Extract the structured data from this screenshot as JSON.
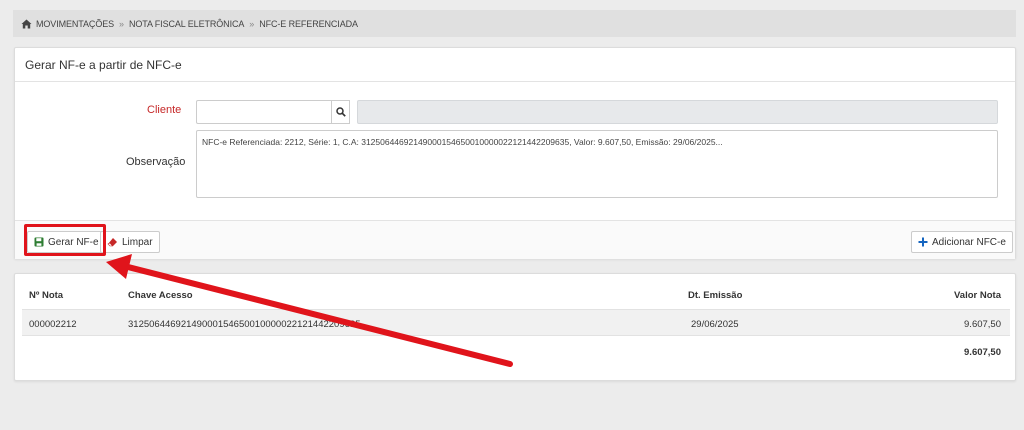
{
  "breadcrumb": {
    "items": [
      "MOVIMENTAÇÕES",
      "NOTA FISCAL ELETRÔNICA",
      "NFC-E REFERENCIADA"
    ],
    "separator": "»"
  },
  "form": {
    "title": "Gerar NF-e a partir de NFC-e",
    "cliente_label": "Cliente",
    "cliente_value": "",
    "cliente_name_value": "",
    "observacao_label": "Observação",
    "observacao_value": "NFC-e Referenciada: 2212, Série: 1, C.A: 31250644692149000154650010000022121442209635, Valor: 9.607,50, Emissão: 29/06/2025..."
  },
  "actions": {
    "gerar_label": "Gerar NF-e",
    "limpar_label": "Limpar",
    "adicionar_label": "Adicionar NFC-e"
  },
  "table": {
    "headers": {
      "numero": "Nº Nota",
      "chave": "Chave Acesso",
      "emissao": "Dt. Emissão",
      "valor": "Valor Nota"
    },
    "rows": [
      {
        "numero": "000002212",
        "chave": "31250644692149000154650010000022121442209635",
        "emissao": "29/06/2025",
        "valor": "9.607,50"
      }
    ],
    "total": "9.607,50"
  },
  "colors": {
    "highlight": "#e0141b",
    "required_label": "#c62828",
    "save_icon": "#2e7d32",
    "eraser_icon": "#c62828",
    "add_icon": "#1565c0"
  }
}
